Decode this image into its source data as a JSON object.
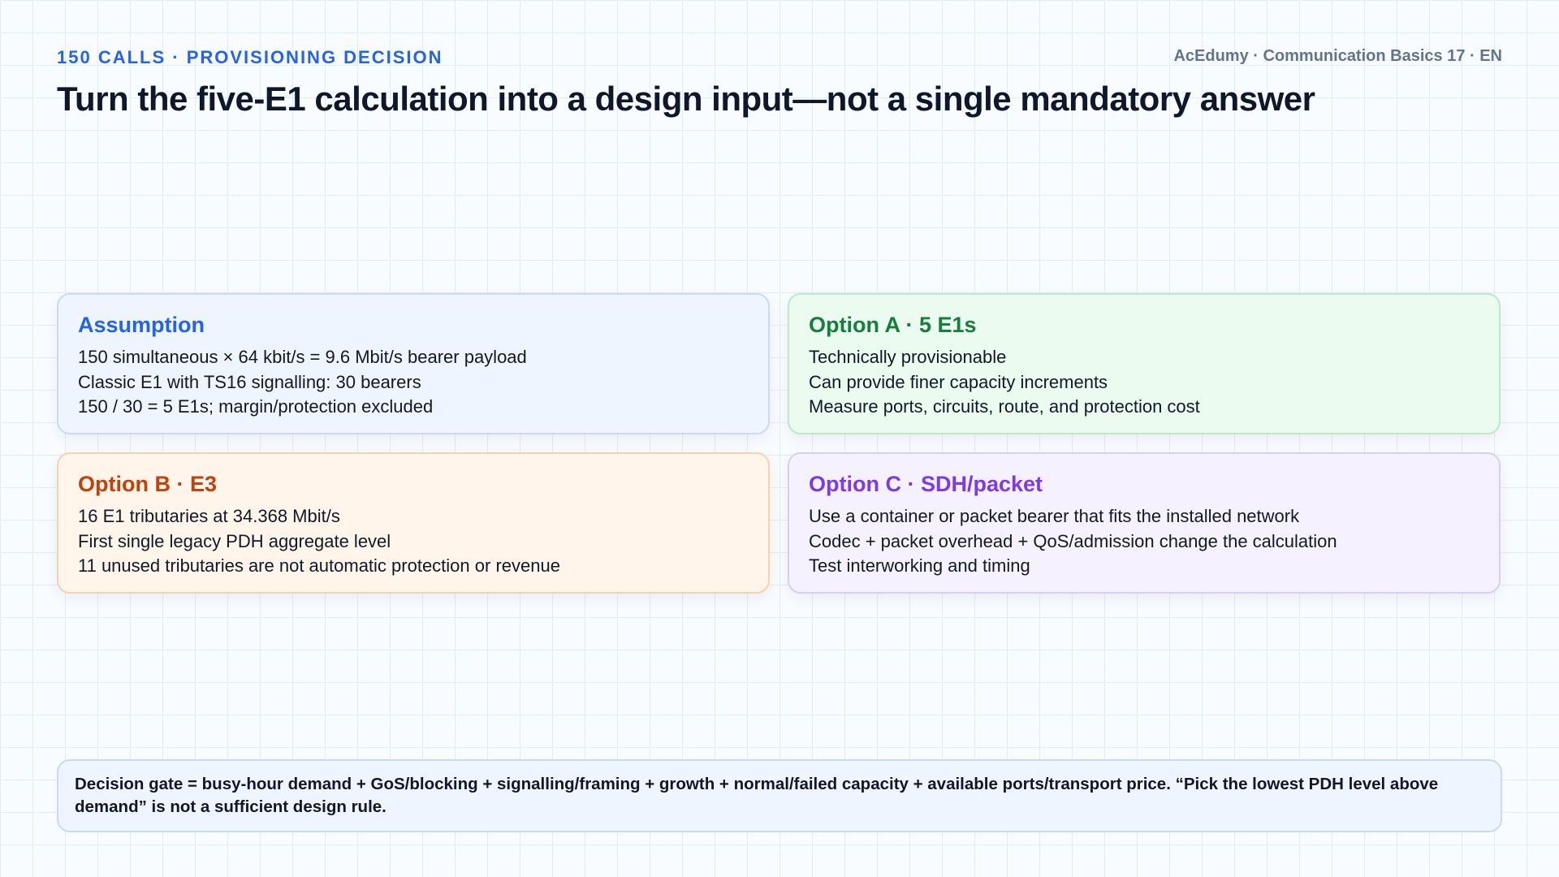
{
  "header": {
    "kicker": "150 CALLS · PROVISIONING DECISION",
    "brand": "AcEdumy · Communication Basics 17 · EN",
    "title": "Turn the five-E1 calculation into a design input—not a single mandatory answer"
  },
  "cards": {
    "assumption": {
      "title": "Assumption",
      "lines": [
        "150 simultaneous × 64 kbit/s = 9.6 Mbit/s bearer payload",
        "Classic E1 with TS16 signalling: 30 bearers",
        "150 / 30 = 5 E1s; margin/protection excluded"
      ]
    },
    "option_a": {
      "title": "Option A · 5 E1s",
      "lines": [
        "Technically provisionable",
        "Can provide finer capacity increments",
        "Measure ports, circuits, route, and protection cost"
      ]
    },
    "option_b": {
      "title": "Option B · E3",
      "lines": [
        "16 E1 tributaries at 34.368 Mbit/s",
        "First single legacy PDH aggregate level",
        "11 unused tributaries are not automatic protection or revenue"
      ]
    },
    "option_c": {
      "title": "Option C · SDH/packet",
      "lines": [
        "Use a container or packet bearer that fits the installed network",
        "Codec + packet overhead + QoS/admission change the calculation",
        "Test interworking and timing"
      ]
    }
  },
  "decision_gate": {
    "text": "Decision gate = busy-hour demand + GoS/blocking + signalling/framing + growth + normal/failed capacity + available ports/transport price. “Pick the lowest PDH level above demand” is not a sufficient design rule."
  },
  "colors": {
    "accent_blue": "#2563eb",
    "accent_green": "#15803d",
    "accent_orange": "#c2410c",
    "accent_purple": "#7c3aed"
  }
}
